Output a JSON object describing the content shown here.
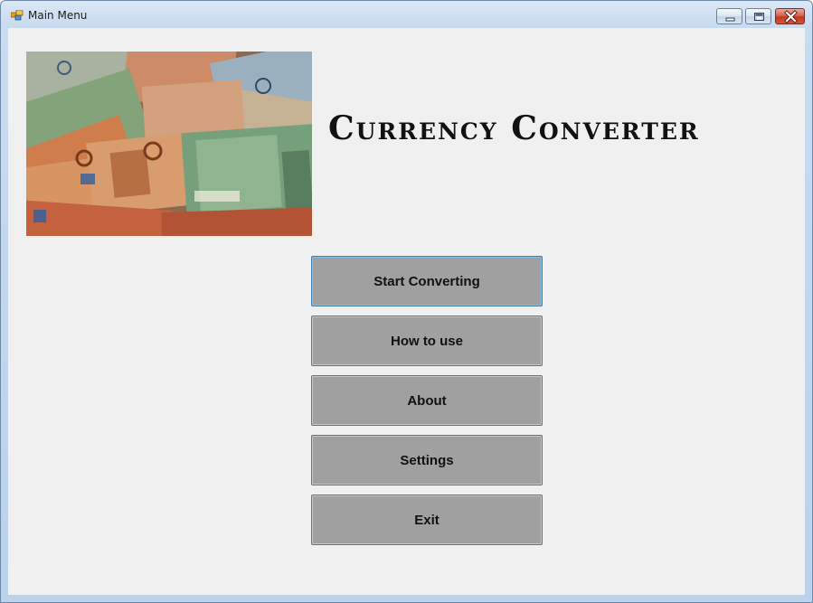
{
  "window": {
    "title": "Main Menu",
    "controls": {
      "minimize_icon": "minimize-icon",
      "maximize_icon": "maximize-icon",
      "close_icon": "close-icon"
    }
  },
  "header": {
    "title": "Currency Converter",
    "banner_image": "euro-banknotes-image"
  },
  "menu": {
    "buttons": [
      {
        "label": "Start Converting",
        "focused": true
      },
      {
        "label": "How to use"
      },
      {
        "label": "About"
      },
      {
        "label": "Settings"
      },
      {
        "label": "Exit"
      }
    ]
  },
  "colors": {
    "button_face": "#a0a0a0",
    "client_background": "#f0f0f0",
    "focus_border": "#3c7fb1",
    "close_button": "#c0391f"
  }
}
